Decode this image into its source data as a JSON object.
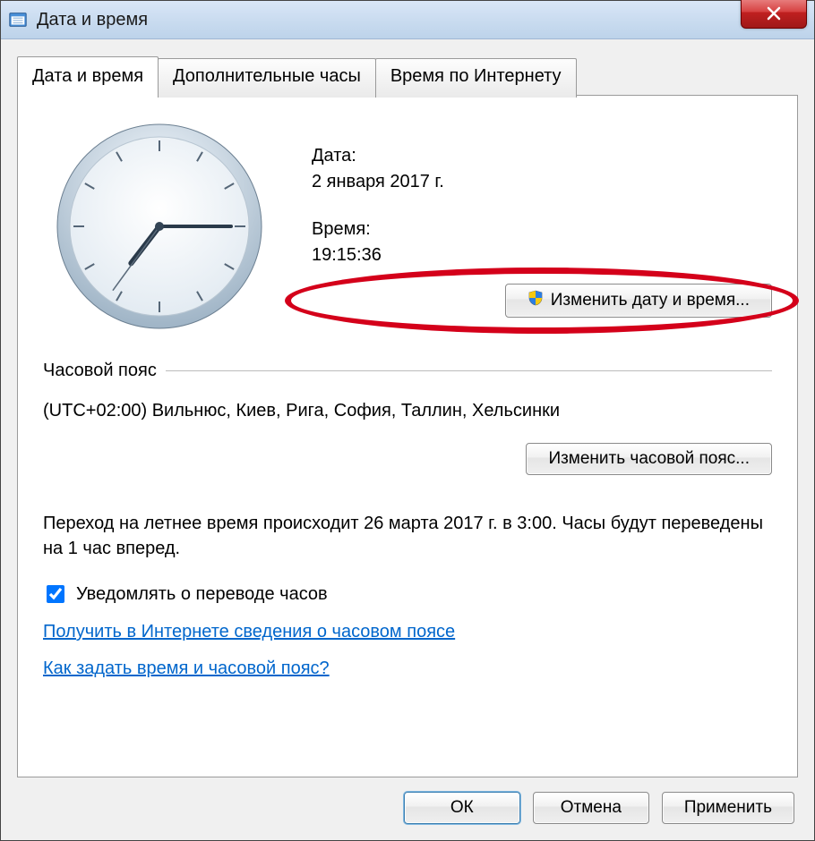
{
  "window": {
    "title": "Дата и время"
  },
  "tabs": [
    {
      "label": "Дата и время"
    },
    {
      "label": "Дополнительные часы"
    },
    {
      "label": "Время по Интернету"
    }
  ],
  "datetime": {
    "date_label": "Дата:",
    "date_value": "2 января 2017 г.",
    "time_label": "Время:",
    "time_value": "19:15:36",
    "change_button": "Изменить дату и время...",
    "clock_display": {
      "hour": 19,
      "minute": 15,
      "second": 36
    }
  },
  "timezone": {
    "section_label": "Часовой пояс",
    "value": "(UTC+02:00) Вильнюс, Киев, Рига, София, Таллин, Хельсинки",
    "change_button": "Изменить часовой пояс..."
  },
  "dst": {
    "text": "Переход на летнее время происходит 26 марта 2017 г. в 3:00. Часы будут переведены на 1 час вперед.",
    "notify_label": "Уведомлять о переводе часов",
    "notify_checked": true
  },
  "links": {
    "tz_info": "Получить в Интернете сведения о часовом поясе",
    "howto": "Как задать время и часовой пояс?"
  },
  "buttons": {
    "ok": "ОК",
    "cancel": "Отмена",
    "apply": "Применить"
  },
  "annotation": {
    "highlight": "change-datetime-button"
  }
}
